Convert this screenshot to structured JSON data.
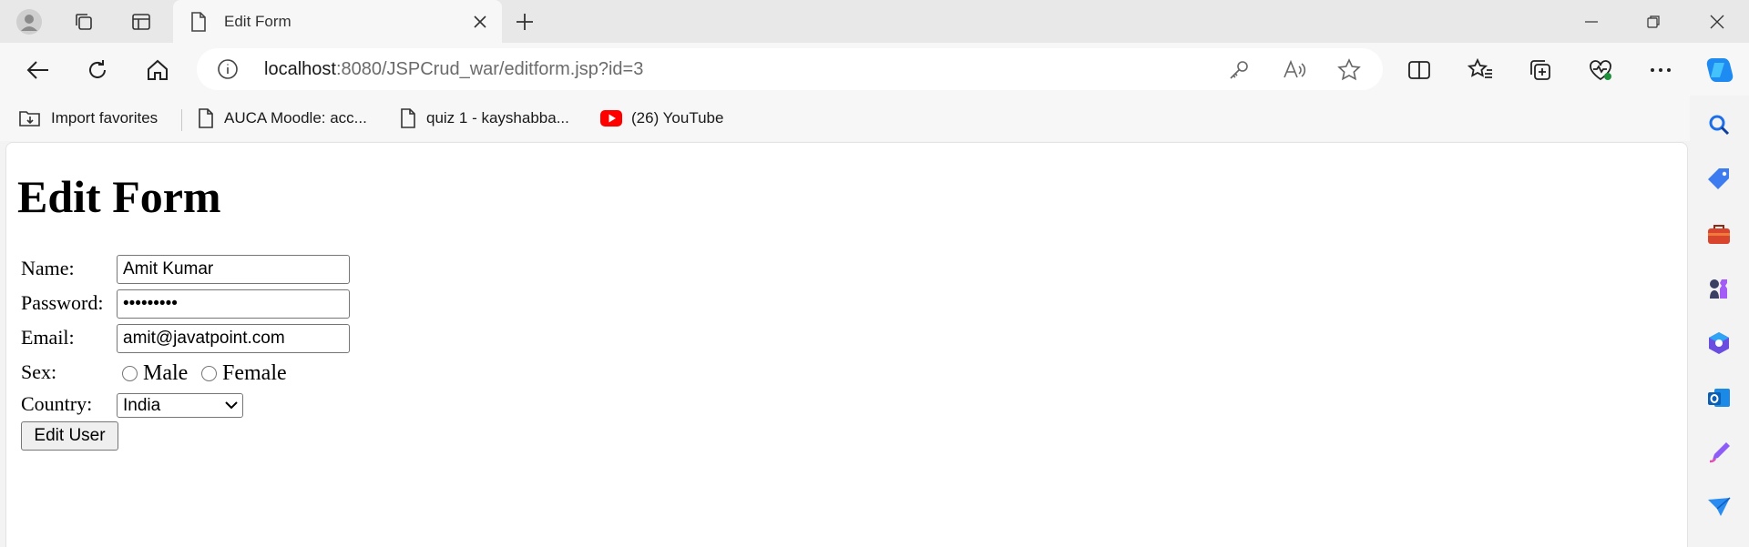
{
  "browser": {
    "tab": {
      "title": "Edit Form"
    },
    "address": {
      "host": "localhost",
      "rest": ":8080/JSPCrud_war/editform.jsp?id=3"
    },
    "bookmarks": [
      {
        "label": "Import favorites",
        "icon": "import-favorites-icon"
      },
      {
        "label": "AUCA Moodle: acc...",
        "icon": "page-icon"
      },
      {
        "label": "quiz 1 - kayshabba...",
        "icon": "page-icon"
      },
      {
        "label": "(26) YouTube",
        "icon": "youtube-icon"
      }
    ]
  },
  "page": {
    "heading": "Edit Form",
    "form": {
      "name_label": "Name:",
      "name_value": "Amit Kumar",
      "password_label": "Password:",
      "password_value": "•••••••••",
      "email_label": "Email:",
      "email_value": "amit@javatpoint.com",
      "sex_label": "Sex:",
      "sex_options": [
        "Male",
        "Female"
      ],
      "country_label": "Country:",
      "country_value": "India",
      "submit_label": "Edit User"
    }
  },
  "colors": {
    "youtube_red": "#ff0000",
    "copilot_blue": "#1d8bf1"
  }
}
